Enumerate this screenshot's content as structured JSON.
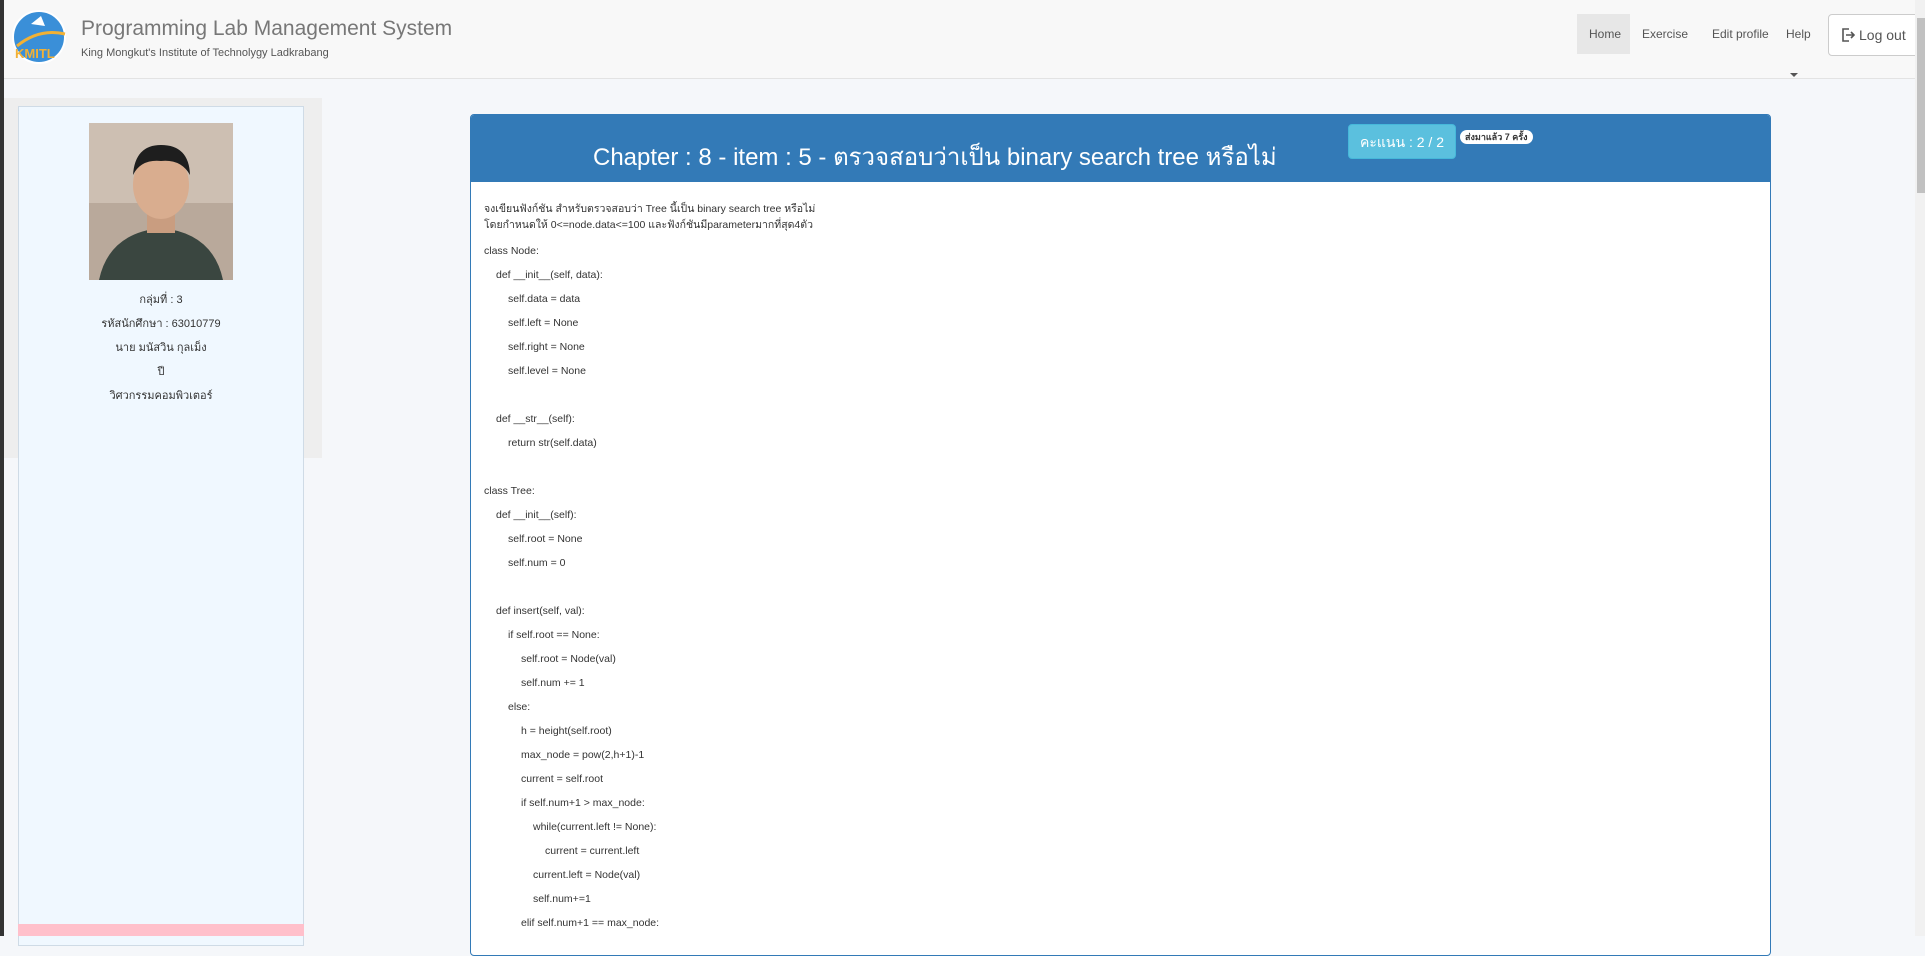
{
  "header": {
    "title": "Programming Lab Management System",
    "subtitle": "King Mongkut's Institute of Technolygy Ladkrabang",
    "logo_text": "KMITL",
    "nav": {
      "home": "Home",
      "exercise": "Exercise",
      "edit_profile": "Edit profile",
      "help": "Help",
      "logout": "Log out"
    }
  },
  "profile": {
    "group": "กลุ่มที่ : 3",
    "student_id": "รหัสนักศึกษา : 63010779",
    "name": "นาย มนัสวิน กุลเม็ง",
    "year": "ปี",
    "department": "วิศวกรรมคอมพิวเตอร์"
  },
  "exercise": {
    "title": "Chapter : 8 - item : 5 - ตรวจสอบว่าเป็น binary search tree หรือไม่",
    "score": "คะแนน : 2 / 2",
    "submitted": "ส่งมาแล้ว 7 ครั้ง",
    "description_line1": "จงเขียนฟังก์ชัน สำหรับตรวจสอบว่า Tree นี้เป็น binary search tree หรือไม่",
    "description_line2": "โดยกำหนดให้ 0<=node.data<=100 และฟังก์ชันมีparameterมากที่สุด4ตัว",
    "code": [
      "class Node:",
      "def __init__(self, data):",
      "self.data = data",
      "self.left = None",
      "self.right = None",
      "self.level = None",
      "def __str__(self):",
      "return str(self.data)",
      "class Tree:",
      "def __init__(self):",
      "self.root = None",
      "self.num = 0",
      "def insert(self, val):",
      "if self.root == None:",
      "self.root = Node(val)",
      "self.num += 1",
      "else:",
      "h = height(self.root)",
      "max_node = pow(2,h+1)-1",
      "current = self.root",
      "if self.num+1 > max_node:",
      "while(current.left != None):",
      "current = current.left",
      "current.left = Node(val)",
      "self.num+=1",
      "elif self.num+1 == max_node:"
    ]
  },
  "colors": {
    "primary": "#337ab7",
    "info": "#5bc0de",
    "sidebar_bg": "#f0f8ff",
    "pink": "#ffc0cb"
  }
}
